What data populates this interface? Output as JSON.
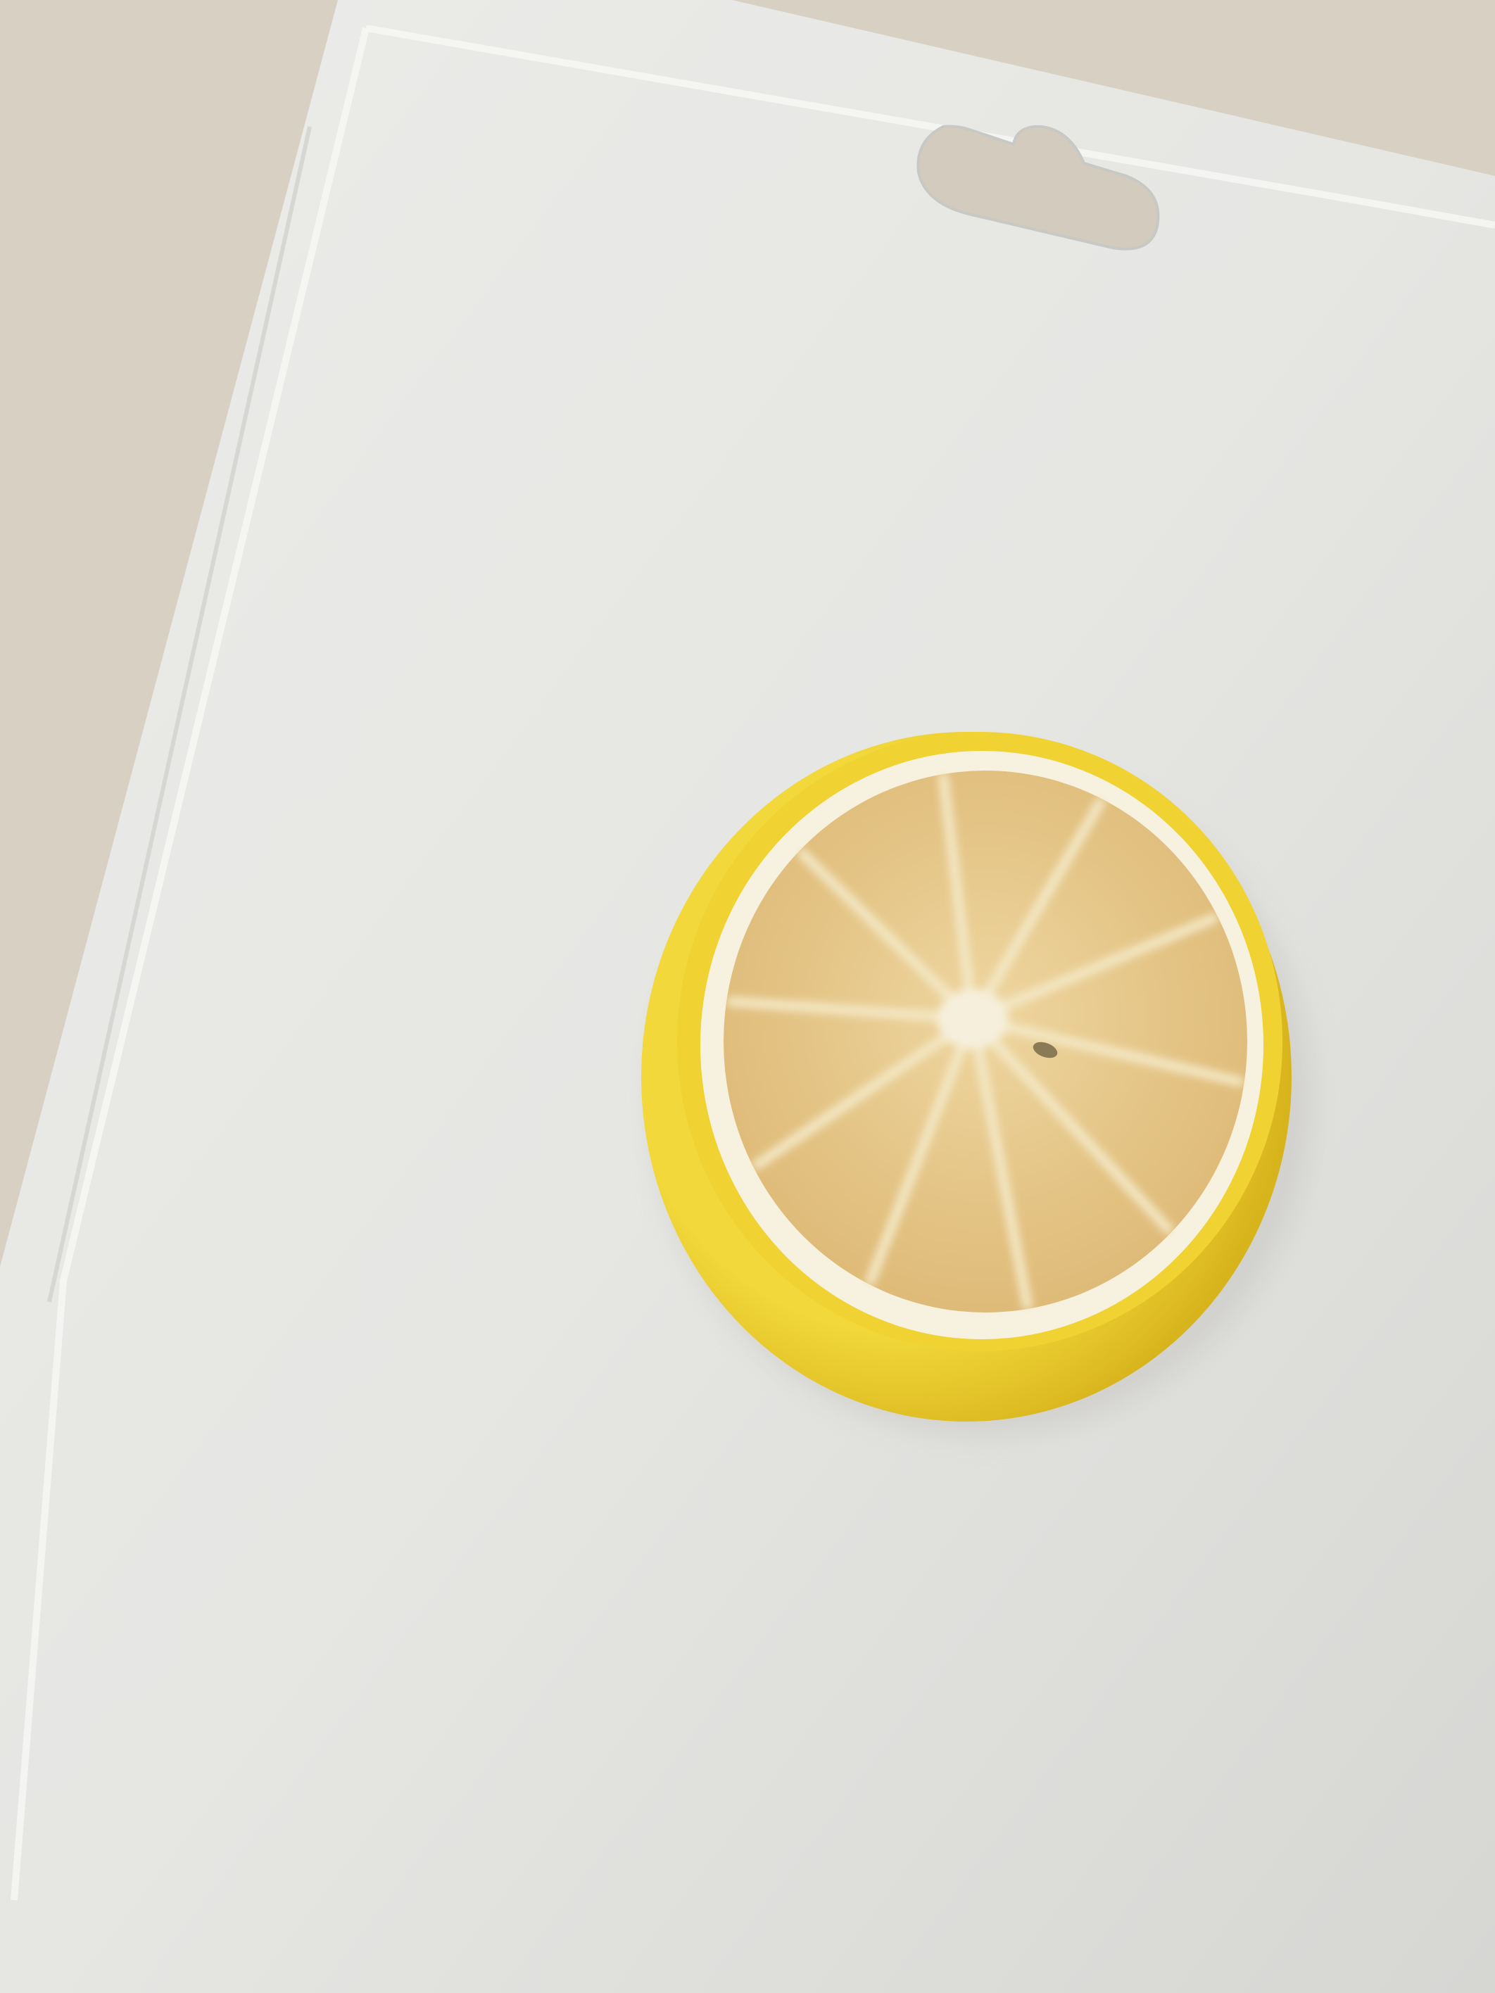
{
  "scene": {
    "colors": {
      "counter": "#d8d1c3",
      "board": "#e9e9e7",
      "board_shadow": "#cfcfcc",
      "board_rim": "#f4f4f2",
      "peel": "#f0d232",
      "peel_dark": "#d9b51c",
      "pith": "#f6f1df",
      "pulp": "#e3c27e",
      "pulp_light": "#ecd198",
      "membrane": "#f3e7c4"
    }
  }
}
